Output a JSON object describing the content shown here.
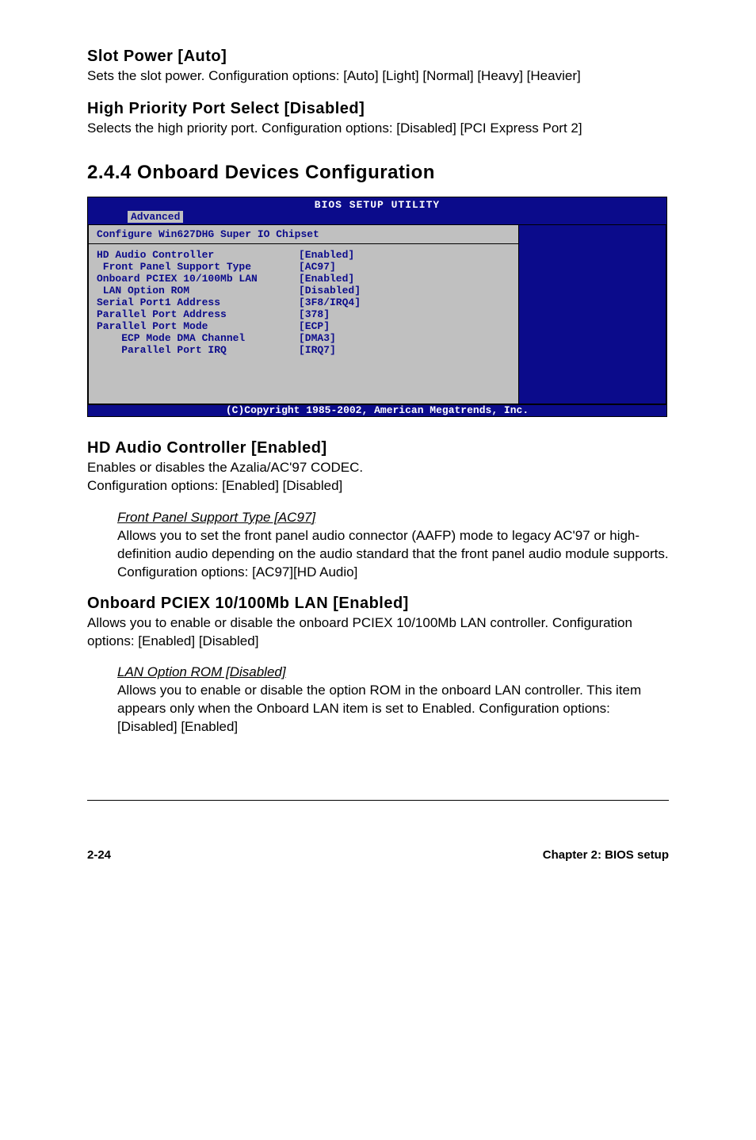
{
  "sections": {
    "slot_power": {
      "heading": "Slot Power [Auto]",
      "body": "Sets the slot power. Configuration options: [Auto] [Light] [Normal] [Heavy] [Heavier]"
    },
    "high_priority": {
      "heading": "High Priority Port Select [Disabled]",
      "body": "Selects the high priority port. Configuration options: [Disabled] [PCI Express Port 2]"
    },
    "onboard_devices": {
      "heading": "2.4.4   Onboard Devices Configuration"
    },
    "hd_audio": {
      "heading": "HD Audio Controller [Enabled]",
      "body1": "Enables or disables the Azalia/AC'97 CODEC.",
      "body2": "Configuration options: [Enabled] [Disabled]",
      "sub_heading": "Front Panel Support Type [AC97]",
      "sub_body": "Allows you to set the front panel audio connector (AAFP) mode to legacy AC'97 or high-definition audio depending on the audio standard that the front panel audio module supports. Configuration options: [AC97][HD Audio]"
    },
    "onboard_pciex": {
      "heading": "Onboard PCIEX 10/100Mb LAN [Enabled]",
      "body": "Allows you to enable or disable the onboard PCIEX 10/100Mb LAN controller.  Configuration options: [Enabled] [Disabled]",
      "sub_heading": "LAN Option ROM [Disabled]",
      "sub_body": "Allows you to enable or disable the option ROM in the onboard LAN controller. This item appears only when the Onboard LAN item is set to Enabled. Configuration options: [Disabled] [Enabled]"
    }
  },
  "bios": {
    "title": "BIOS SETUP UTILITY",
    "tab": "Advanced",
    "config_title": "Configure Win627DHG Super IO Chipset",
    "rows": [
      {
        "label": "HD Audio Controller",
        "value": "[Enabled]"
      },
      {
        "label": " Front Panel Support Type",
        "value": "[AC97]"
      },
      {
        "label": "Onboard PCIEX 10/100Mb LAN",
        "value": "[Enabled]"
      },
      {
        "label": " LAN Option ROM",
        "value": "[Disabled]"
      },
      {
        "label": "",
        "value": ""
      },
      {
        "label": "Serial Port1 Address",
        "value": "[3F8/IRQ4]"
      },
      {
        "label": "Parallel Port Address",
        "value": "[378]"
      },
      {
        "label": "Parallel Port Mode",
        "value": "[ECP]"
      },
      {
        "label": "    ECP Mode DMA Channel",
        "value": "[DMA3]"
      },
      {
        "label": "    Parallel Port IRQ",
        "value": "[IRQ7]"
      }
    ],
    "footer": "(C)Copyright 1985-2002, American Megatrends, Inc."
  },
  "footer": {
    "left": "2-24",
    "right": "Chapter 2: BIOS setup"
  }
}
